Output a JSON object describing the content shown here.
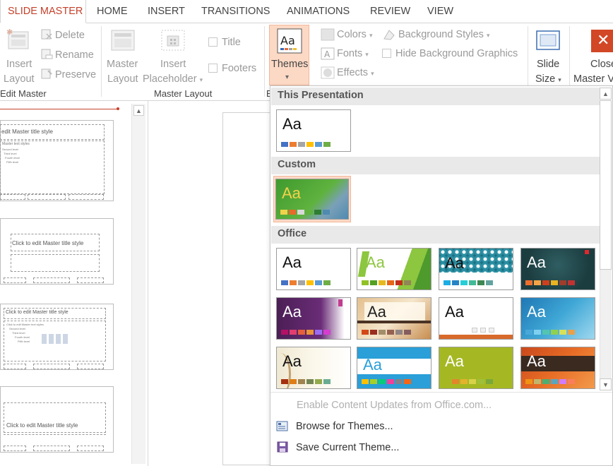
{
  "tabs": [
    "SLIDE MASTER",
    "HOME",
    "INSERT",
    "TRANSITIONS",
    "ANIMATIONS",
    "REVIEW",
    "VIEW"
  ],
  "ribbon": {
    "edit_master": {
      "insert_line1": "Insert",
      "insert_line2": "Layout",
      "delete": "Delete",
      "rename": "Rename",
      "preserve": "Preserve",
      "group_label": "Edit Master"
    },
    "master_layout": {
      "master_line1": "Master",
      "master_line2": "Layout",
      "insert_line1": "Insert",
      "insert_line2": "Placeholder",
      "title": "Title",
      "footers": "Footers",
      "group_label": "Master Layout"
    },
    "edit_theme": {
      "themes": "Themes",
      "themes_icon_text": "Aa",
      "group_label_partial": "E"
    },
    "background": {
      "colors": "Colors",
      "fonts": "Fonts",
      "effects": "Effects",
      "background_styles": "Background Styles",
      "hide_background": "Hide Background Graphics"
    },
    "size": {
      "slide_line1": "Slide",
      "slide_line2": "Size"
    },
    "close": {
      "close_line1": "Close",
      "close_line2": "Master V"
    }
  },
  "thumbnails": [
    {
      "title": "edit Master title style",
      "body": [
        "Master text styles",
        "Second level",
        "Third level",
        "Fourth level",
        "Fifth level"
      ]
    },
    {
      "title": "Click to edit Master title style"
    },
    {
      "title": "Click to edit Master title style",
      "body": [
        "Click to edit Master text styles",
        "Second level",
        "Third level",
        "Fourth level",
        "Fifth level"
      ]
    },
    {
      "title": "Click to edit Master title style"
    }
  ],
  "themes_dropdown": {
    "sections": {
      "this_presentation": "This Presentation",
      "custom": "Custom",
      "office": "Office"
    },
    "sample_text": "Aa",
    "menu": {
      "enable_updates": "Enable Content Updates from Office.com...",
      "browse": "Browse for Themes...",
      "save": "Save Current Theme..."
    }
  },
  "colors": {
    "accent_red": "#c5412b",
    "hover_orange": "#fcd9c5",
    "close_button": "#d24726"
  }
}
